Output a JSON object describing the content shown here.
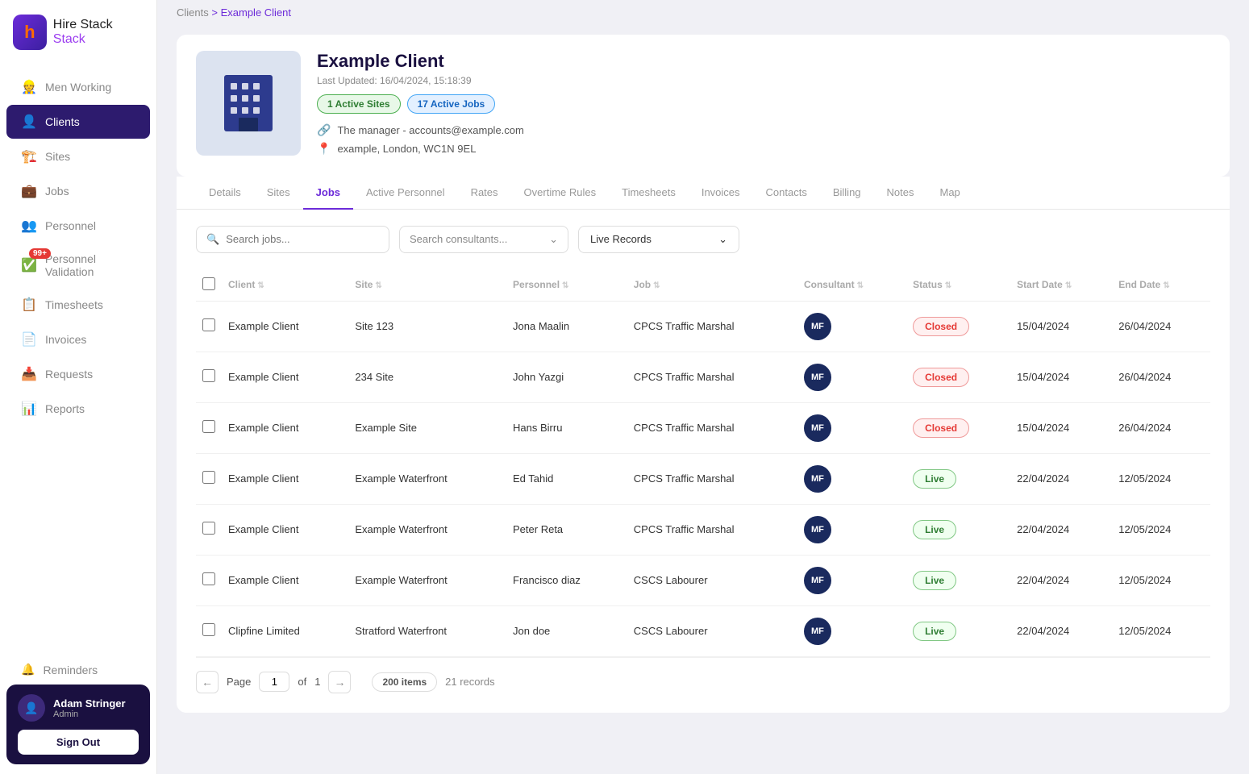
{
  "app": {
    "name": "Hire Stack",
    "logo_letter": "h"
  },
  "breadcrumb": {
    "parent": "Clients",
    "current": "Example Client"
  },
  "sidebar": {
    "items": [
      {
        "id": "men-working",
        "label": "Men Working",
        "icon": "👷"
      },
      {
        "id": "clients",
        "label": "Clients",
        "icon": "👤",
        "active": true
      },
      {
        "id": "sites",
        "label": "Sites",
        "icon": "🏗️"
      },
      {
        "id": "jobs",
        "label": "Jobs",
        "icon": "💼"
      },
      {
        "id": "personnel",
        "label": "Personnel",
        "icon": "👥"
      },
      {
        "id": "personnel-validation",
        "label": "Personnel Validation",
        "icon": "✅",
        "badge": "99+"
      },
      {
        "id": "timesheets",
        "label": "Timesheets",
        "icon": "📋"
      },
      {
        "id": "invoices",
        "label": "Invoices",
        "icon": "📄"
      },
      {
        "id": "requests",
        "label": "Requests",
        "icon": "📥"
      },
      {
        "id": "reports",
        "label": "Reports",
        "icon": "📊"
      }
    ],
    "reminders": "Reminders",
    "user": {
      "name": "Adam Stringer",
      "role": "Admin",
      "sign_out_label": "Sign Out"
    }
  },
  "client": {
    "name": "Example Client",
    "last_updated": "Last Updated: 16/04/2024, 15:18:39",
    "badge_sites": "1 Active Sites",
    "badge_jobs": "17 Active Jobs",
    "contact": "The manager - accounts@example.com",
    "address": "example, London, WC1N 9EL"
  },
  "tabs": [
    {
      "id": "details",
      "label": "Details"
    },
    {
      "id": "sites",
      "label": "Sites"
    },
    {
      "id": "jobs",
      "label": "Jobs",
      "active": true
    },
    {
      "id": "active-personnel",
      "label": "Active Personnel"
    },
    {
      "id": "rates",
      "label": "Rates"
    },
    {
      "id": "overtime-rules",
      "label": "Overtime Rules"
    },
    {
      "id": "timesheets",
      "label": "Timesheets"
    },
    {
      "id": "invoices",
      "label": "Invoices"
    },
    {
      "id": "contacts",
      "label": "Contacts"
    },
    {
      "id": "billing",
      "label": "Billing"
    },
    {
      "id": "notes",
      "label": "Notes"
    },
    {
      "id": "map",
      "label": "Map"
    }
  ],
  "filters": {
    "search_placeholder": "Search jobs...",
    "consultant_placeholder": "Search consultants...",
    "record_filter": "Live Records",
    "chevron_down": "⌄"
  },
  "table": {
    "columns": [
      {
        "id": "client",
        "label": "Client"
      },
      {
        "id": "site",
        "label": "Site"
      },
      {
        "id": "personnel",
        "label": "Personnel"
      },
      {
        "id": "job",
        "label": "Job"
      },
      {
        "id": "consultant",
        "label": "Consultant"
      },
      {
        "id": "status",
        "label": "Status"
      },
      {
        "id": "start_date",
        "label": "Start Date"
      },
      {
        "id": "end_date",
        "label": "End Date"
      }
    ],
    "rows": [
      {
        "client": "Example Client",
        "site": "Site 123",
        "personnel": "Jona Maalin",
        "job": "CPCS Traffic Marshal",
        "consultant": "MF",
        "status": "Closed",
        "start_date": "15/04/2024",
        "end_date": "26/04/2024"
      },
      {
        "client": "Example Client",
        "site": "234 Site",
        "personnel": "John Yazgi",
        "job": "CPCS Traffic Marshal",
        "consultant": "MF",
        "status": "Closed",
        "start_date": "15/04/2024",
        "end_date": "26/04/2024"
      },
      {
        "client": "Example Client",
        "site": "Example Site",
        "personnel": "Hans Birru",
        "job": "CPCS Traffic Marshal",
        "consultant": "MF",
        "status": "Closed",
        "start_date": "15/04/2024",
        "end_date": "26/04/2024"
      },
      {
        "client": "Example Client",
        "site": "Example Waterfront",
        "personnel": "Ed Tahid",
        "job": "CPCS Traffic Marshal",
        "consultant": "MF",
        "status": "Live",
        "start_date": "22/04/2024",
        "end_date": "12/05/2024"
      },
      {
        "client": "Example Client",
        "site": "Example Waterfront",
        "personnel": "Peter Reta",
        "job": "CPCS Traffic Marshal",
        "consultant": "MF",
        "status": "Live",
        "start_date": "22/04/2024",
        "end_date": "12/05/2024"
      },
      {
        "client": "Example Client",
        "site": "Example Waterfront",
        "personnel": "Francisco diaz",
        "job": "CSCS Labourer",
        "consultant": "MF",
        "status": "Live",
        "start_date": "22/04/2024",
        "end_date": "12/05/2024"
      },
      {
        "client": "Clipfine Limited",
        "site": "Stratford Waterfront",
        "personnel": "Jon doe",
        "job": "CSCS Labourer",
        "consultant": "MF",
        "status": "Live",
        "start_date": "22/04/2024",
        "end_date": "12/05/2024"
      }
    ]
  },
  "pagination": {
    "prev": "←",
    "next": "→",
    "page_label": "Page",
    "current_page": "1",
    "of_label": "of",
    "total_pages": "1",
    "items_count": "200 items",
    "records_count": "21 records"
  }
}
